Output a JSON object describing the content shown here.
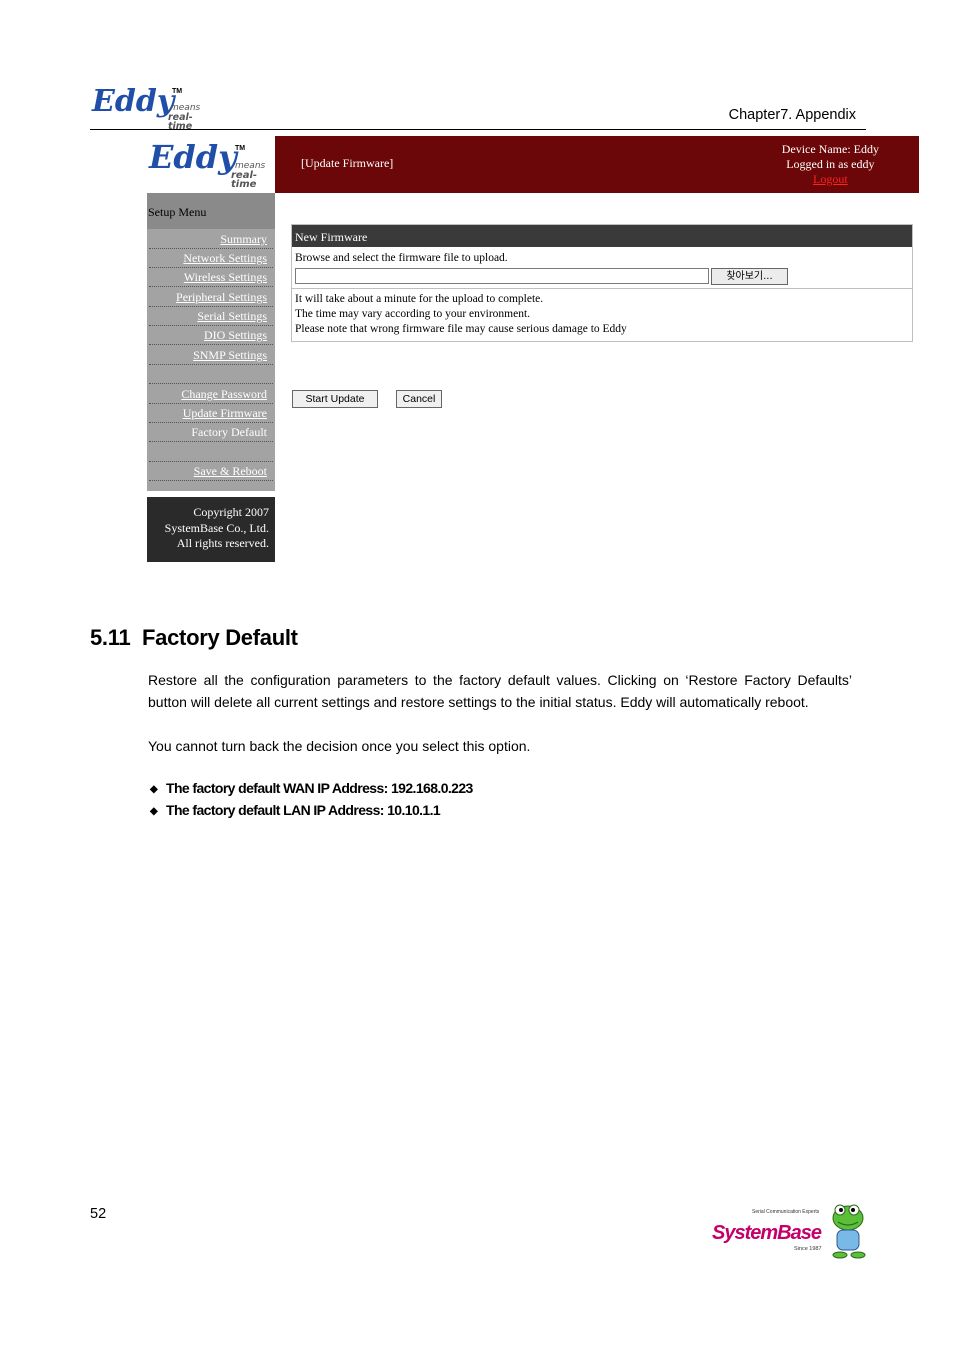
{
  "header": {
    "logo_text": "Eddy",
    "logo_tm": "TM",
    "logo_sub1": "means",
    "logo_sub2": "real-time",
    "chapter": "Chapter7. Appendix"
  },
  "screenshot": {
    "logo_text": "Eddy",
    "logo_tm": "TM",
    "logo_sub1": "means",
    "logo_sub2": "real-time",
    "page_title": "[Update Firmware]",
    "device_name": "Device Name: Eddy",
    "logged_in": "Logged in as eddy",
    "logout": "Logout",
    "colors": {
      "banner": "#6b0708",
      "menu": "#a3a3a3",
      "logout": "#ff2020"
    },
    "sidebar": {
      "heading": "Setup Menu",
      "items": [
        {
          "label": "Summary"
        },
        {
          "label": "Network Settings"
        },
        {
          "label": "Wireless Settings"
        },
        {
          "label": "Peripheral Settings"
        },
        {
          "label": "Serial Settings"
        },
        {
          "label": "DIO Settings"
        },
        {
          "label": "SNMP Settings"
        },
        {
          "label": ""
        },
        {
          "label": "Change Password"
        },
        {
          "label": "Update Firmware"
        },
        {
          "label": "Factory Default"
        },
        {
          "label": ""
        },
        {
          "label": "Save & Reboot"
        }
      ],
      "footer": [
        "Copyright 2007",
        "SystemBase Co., Ltd.",
        "All rights reserved."
      ]
    },
    "firmware_box": {
      "heading": "New Firmware",
      "instruction": "Browse and select the firmware file to upload.",
      "file_value": "",
      "browse_label": "찾아보기...",
      "notes": [
        "It will take about a minute for the upload to complete.",
        "The time may vary according to your environment.",
        "Please note that wrong firmware file may cause serious damage to Eddy"
      ]
    },
    "buttons": {
      "start": "Start Update",
      "cancel": "Cancel"
    }
  },
  "section": {
    "title": "5.11  Factory Default",
    "para1": "Restore all the configuration parameters to the factory default values. Clicking on  ‘Restore Factory Defaults’ button will delete all current settings and restore settings to the initial status. Eddy will automatically reboot.",
    "para2": "You cannot turn back the decision once you select this option.",
    "bullets": [
      "The factory default WAN IP Address: 192.168.0.223",
      "The factory default LAN IP Address: 10.10.1.1"
    ]
  },
  "footer": {
    "page_number": "52",
    "brand_tagline": "Serial Communication Experts",
    "brand": "SystemBase",
    "since": "Since 1987"
  }
}
